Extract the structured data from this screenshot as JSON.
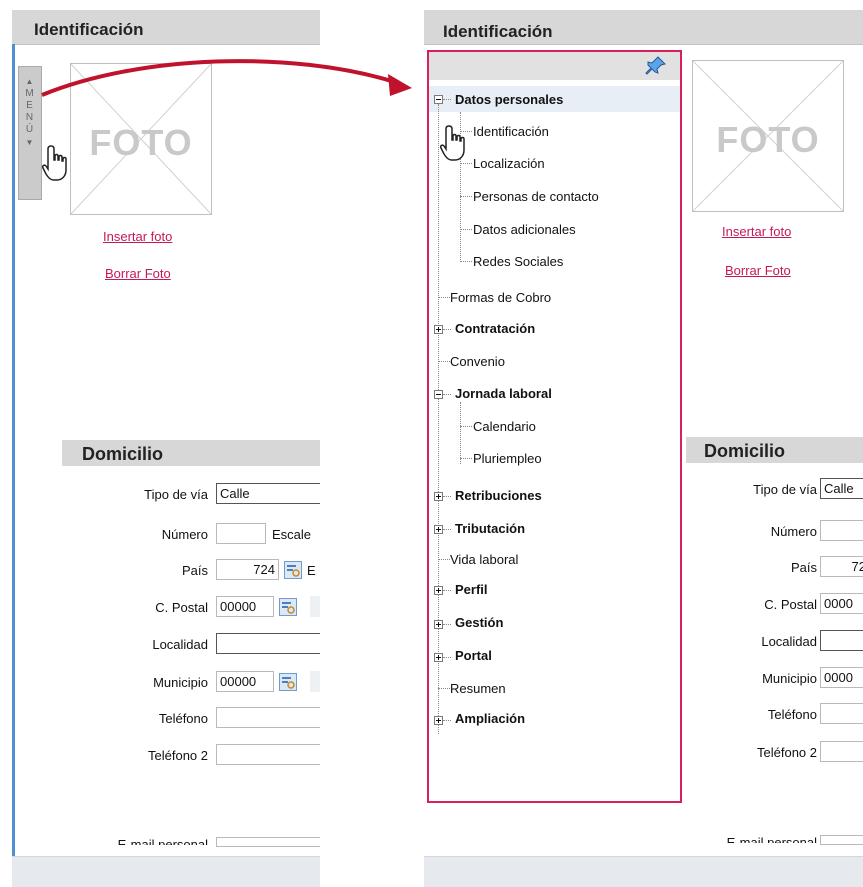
{
  "left": {
    "title": "Identificación",
    "menu_tab": "MENÚ",
    "photo_label": "FOTO",
    "insert_photo": "Insertar foto",
    "delete_photo": "Borrar Foto",
    "section_title": "Domicilio",
    "fields": {
      "tipo_via_label": "Tipo de vía",
      "tipo_via_value": "Calle",
      "numero_label": "Número",
      "escalera_label": "Escale",
      "pais_label": "País",
      "pais_value": "724",
      "pais_partial": "E",
      "cpostal_label": "C. Postal",
      "cpostal_value": "00000",
      "localidad_label": "Localidad",
      "municipio_label": "Municipio",
      "municipio_value": "00000",
      "telefono_label": "Teléfono",
      "telefono2_label": "Teléfono 2",
      "email_label": "E-mail personal"
    }
  },
  "right": {
    "title": "Identificación",
    "photo_label": "FOTO",
    "insert_photo": "Insertar foto",
    "delete_photo": "Borrar Foto",
    "section_title": "Domicilio",
    "fields": {
      "tipo_via_label": "Tipo de vía",
      "tipo_via_value": "Calle",
      "numero_label": "Número",
      "pais_label": "País",
      "pais_value": "72",
      "cpostal_label": "C. Postal",
      "cpostal_value": "0000",
      "localidad_label": "Localidad",
      "municipio_label": "Municipio",
      "municipio_value": "0000",
      "telefono_label": "Teléfono",
      "telefono2_label": "Teléfono 2",
      "email_label": "E-mail personal"
    },
    "tree": {
      "datos_personales": "Datos personales",
      "identificacion": "Identificación",
      "localizacion": "Localización",
      "personas_contacto": "Personas de contacto",
      "datos_adicionales": "Datos adicionales",
      "redes_sociales": "Redes Sociales",
      "formas_cobro": "Formas de Cobro",
      "contratacion": "Contratación",
      "convenio": "Convenio",
      "jornada_laboral": "Jornada laboral",
      "calendario": "Calendario",
      "pluriempleo": "Pluriempleo",
      "retribuciones": "Retribuciones",
      "tributacion": "Tributación",
      "vida_laboral": "Vida laboral",
      "perfil": "Perfil",
      "gestion": "Gestión",
      "portal": "Portal",
      "resumen": "Resumen",
      "ampliacion": "Ampliación"
    }
  },
  "colors": {
    "tree_border": "#d92159",
    "link": "#c5185a",
    "arrow": "#c0122c",
    "header_bg": "#d7d7d7"
  },
  "icons": [
    "pin-icon",
    "hand-pointer-icon",
    "lookup-icon",
    "expand-icon",
    "collapse-icon",
    "photo-placeholder-icon"
  ]
}
